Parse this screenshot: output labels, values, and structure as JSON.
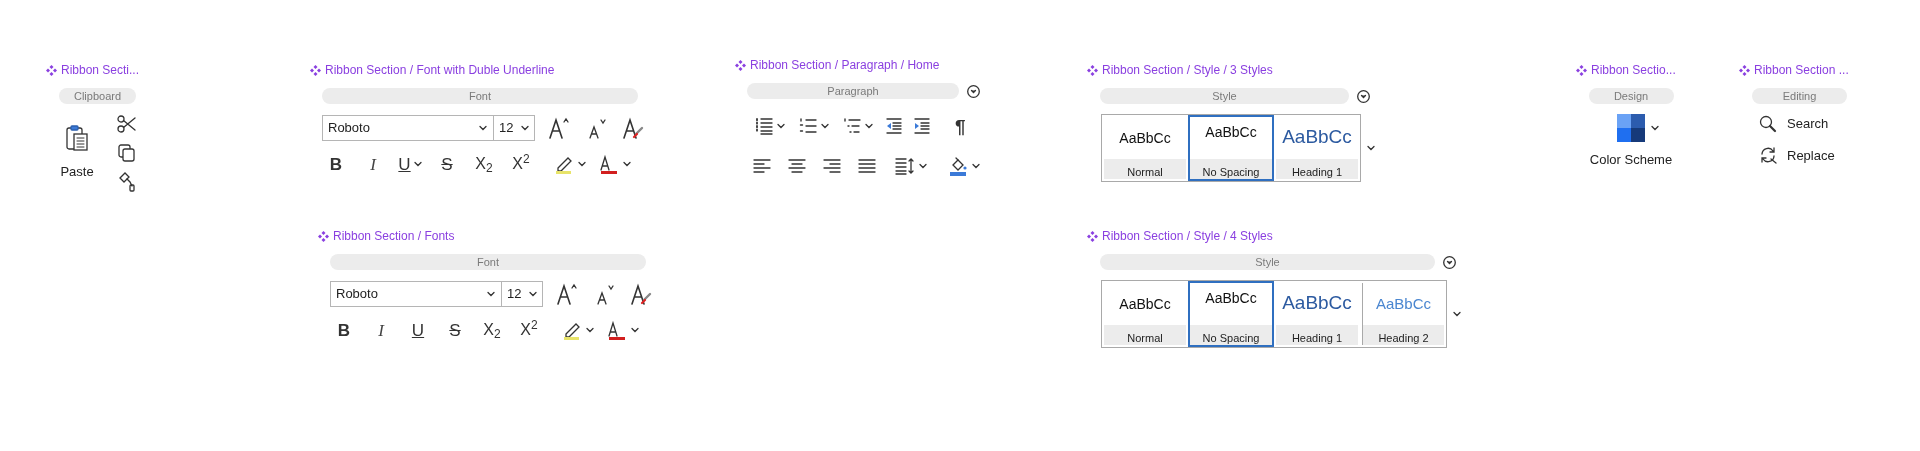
{
  "sections": [
    {
      "kind": "clipboard",
      "title": "Ribbon Secti...",
      "label": "Clipboard",
      "paste_label": "Paste"
    },
    {
      "kind": "font",
      "title": "Ribbon Section /  Font with Duble Underline",
      "label": "Font",
      "font_name": "Roboto",
      "font_size": "12",
      "underline_menu": true,
      "format_buttons": [
        {
          "kind": "bold",
          "glyph": "B"
        },
        {
          "kind": "italic",
          "glyph": "I"
        },
        {
          "kind": "underline",
          "glyph": "U"
        },
        {
          "kind": "strike",
          "glyph": "S"
        },
        {
          "kind": "subscript",
          "glyph": "X$_{2}$"
        },
        {
          "kind": "superscript",
          "glyph": "X$^{2}$"
        }
      ]
    },
    {
      "kind": "font",
      "title": "Ribbon Section / Fonts",
      "label": "Font",
      "font_name": "Roboto",
      "font_size": "12",
      "underline_menu": false,
      "format_buttons": [
        {
          "kind": "bold",
          "glyph": "B"
        },
        {
          "kind": "italic",
          "glyph": "I"
        },
        {
          "kind": "underline",
          "glyph": "U"
        },
        {
          "kind": "strike",
          "glyph": "S"
        },
        {
          "kind": "subscript",
          "glyph": "X$_{2}$"
        },
        {
          "kind": "superscript",
          "glyph": "X$^{2}$"
        }
      ]
    },
    {
      "kind": "paragraph",
      "title": "Ribbon Section / Paragraph / Home",
      "label": "Paragraph",
      "marks_glyph": "¶"
    },
    {
      "kind": "style",
      "title": "Ribbon Section / Style / 3 Styles",
      "label": "Style",
      "styles": [
        {
          "kind": "normal",
          "sample": "AaBbCc",
          "name": "Normal",
          "selected": false
        },
        {
          "kind": "no_spacing",
          "sample": "AaBbCc",
          "name": "No Spacing",
          "selected": true
        },
        {
          "kind": "heading1",
          "sample": "AaBbCc",
          "name": "Heading 1",
          "selected": false
        }
      ]
    },
    {
      "kind": "style",
      "title": "Ribbon Section / Style / 4 Styles",
      "label": "Style",
      "styles": [
        {
          "kind": "normal",
          "sample": "AaBbCc",
          "name": "Normal",
          "selected": false
        },
        {
          "kind": "no_spacing",
          "sample": "AaBbCc",
          "name": "No Spacing",
          "selected": true
        },
        {
          "kind": "heading1",
          "sample": "AaBbCc",
          "name": "Heading 1",
          "selected": false
        },
        {
          "kind": "heading2",
          "sample": "AaBbCc",
          "name": "Heading 2",
          "selected": false
        }
      ]
    },
    {
      "kind": "design",
      "title": "Ribbon Sectio...",
      "label": "Design",
      "button_label": "Color Scheme"
    },
    {
      "kind": "editing",
      "title": "Ribbon Section ...",
      "label": "Editing",
      "commands": [
        {
          "kind": "search",
          "label": "Search"
        },
        {
          "kind": "replace",
          "label": "Replace"
        }
      ]
    }
  ]
}
